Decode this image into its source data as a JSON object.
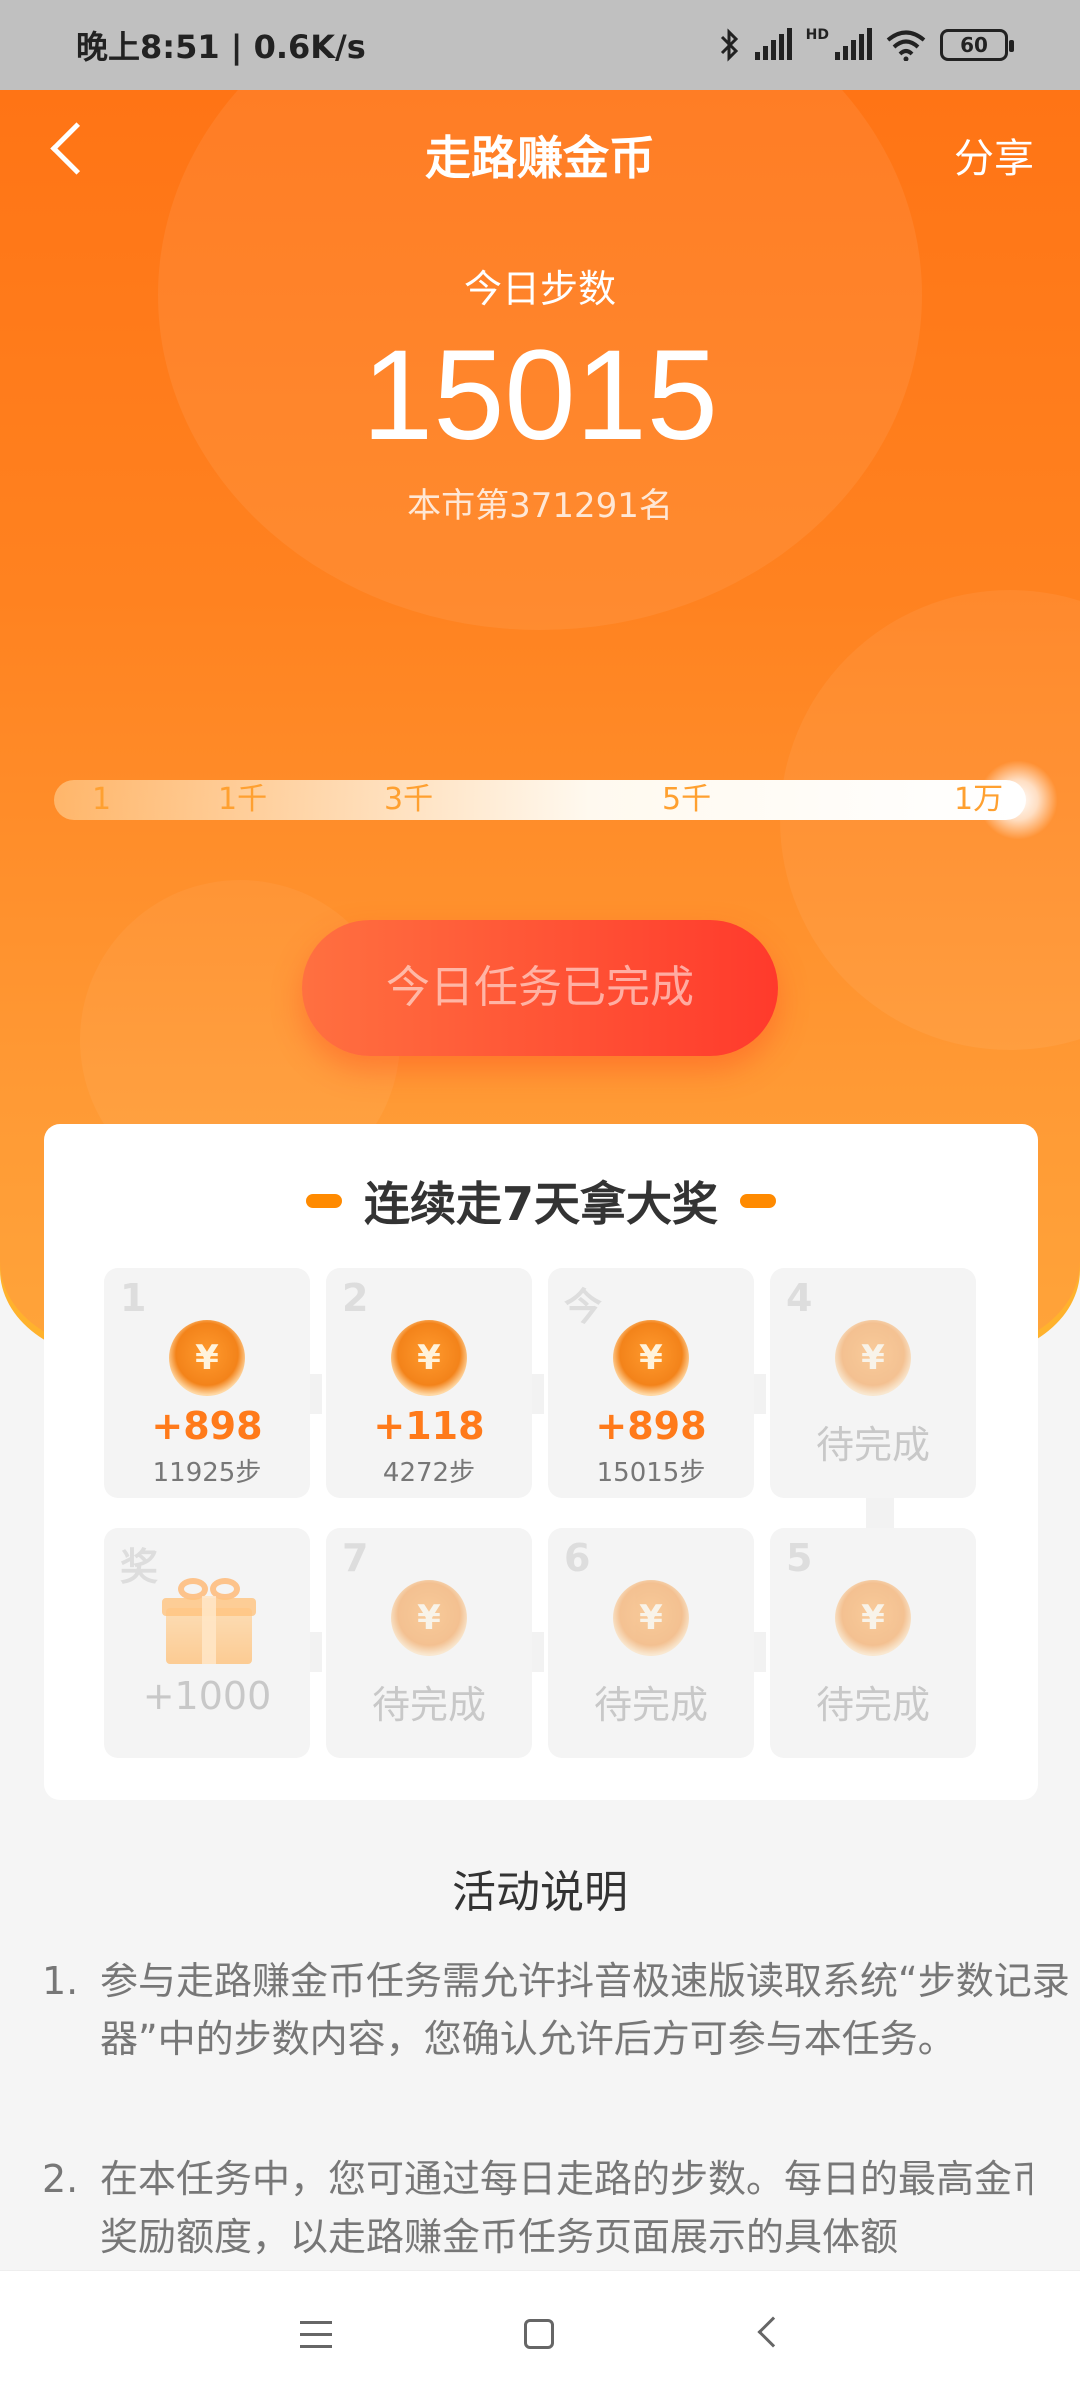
{
  "status": {
    "time": "晚上8:51 | 0.6K/s",
    "hd": "HD",
    "battery": "60"
  },
  "header": {
    "title": "走路赚金币",
    "share": "分享"
  },
  "today": {
    "label": "今日步数",
    "steps": "15015",
    "rank": "本市第371291名"
  },
  "progress": {
    "ticks": [
      "1",
      "1千",
      "3千",
      "5千",
      "1万"
    ],
    "fill_fraction": 1.0
  },
  "task_button": {
    "label": "今日任务已完成"
  },
  "streak": {
    "title": "连续走7天拿大奖",
    "days": [
      {
        "index": "1",
        "reward": "+898",
        "steps": "11925步",
        "status": "done"
      },
      {
        "index": "2",
        "reward": "+118",
        "steps": "4272步",
        "status": "done"
      },
      {
        "index": "今",
        "reward": "+898",
        "steps": "15015步",
        "status": "done"
      },
      {
        "index": "4",
        "label": "待完成",
        "status": "pending"
      },
      {
        "index": "5",
        "label": "待完成",
        "status": "pending"
      },
      {
        "index": "6",
        "label": "待完成",
        "status": "pending"
      },
      {
        "index": "7",
        "label": "待完成",
        "status": "pending"
      }
    ],
    "grand_prize": {
      "index": "奖",
      "reward": "+1000"
    },
    "coin_symbol": "¥"
  },
  "description": {
    "title": "活动说明",
    "items": [
      {
        "num": "1.",
        "text": "参与走路赚金币任务需允许抖音极速版读取系统“步数记录器”中的步数内容，您确认允许后方可参与本任务。"
      },
      {
        "num": "2.",
        "text": "在本任务中，您可通过每日走路的步数。每日的最高金币奖励额度，以走路赚金币任务页面展示的具体额"
      }
    ]
  },
  "colors": {
    "accent": "#ff7a1a",
    "button": "#ff3a2c",
    "hero": "#ff8220"
  }
}
